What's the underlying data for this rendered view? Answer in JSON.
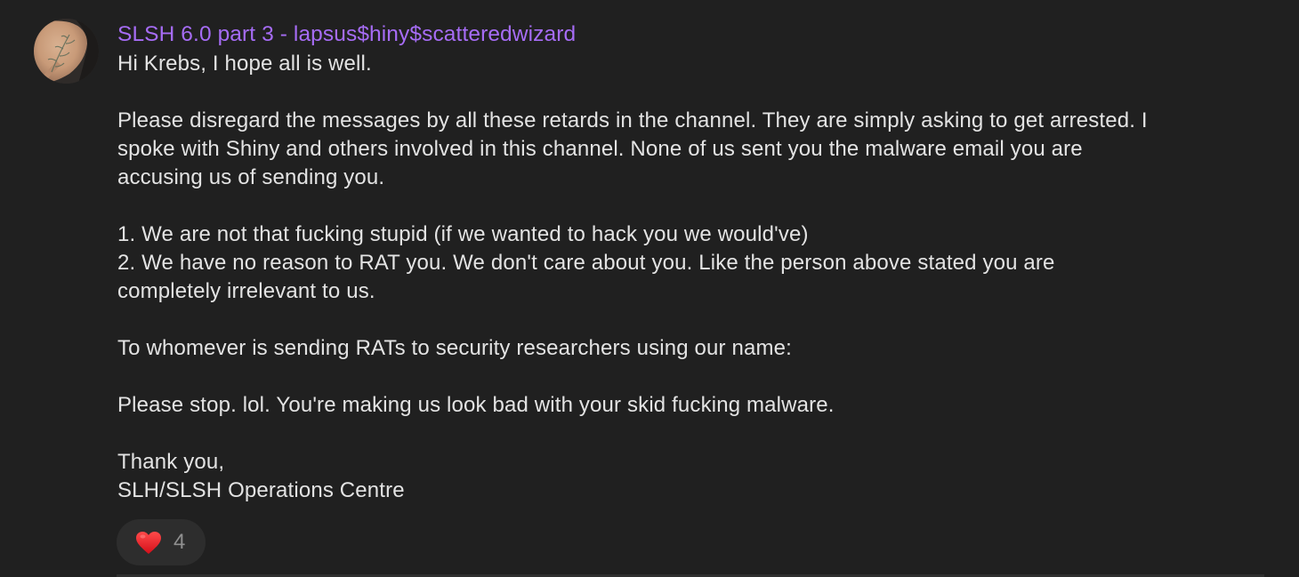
{
  "message": {
    "author": "SLSH 6.0 part 3 - lapsus$hiny$scatteredwizard",
    "author_color": "#a66cf5",
    "paragraphs": [
      [
        "Hi Krebs, I hope all is well."
      ],
      [
        "Please disregard the messages by all these retards in the channel. They are simply asking to get arrested. I",
        "spoke with Shiny and others involved in this channel. None of us sent you the malware email you are",
        "accusing us of sending you."
      ],
      [
        "1. We are not that fucking stupid (if we wanted to hack you we would've)",
        "2. We have no reason to RAT you. We don't care about you. Like the person above stated you are",
        "completely irrelevant to us."
      ],
      [
        "To whomever is sending RATs to security researchers using our name:"
      ],
      [
        "Please stop. lol. You're making us look bad with your skid fucking malware."
      ],
      [
        "Thank you,",
        "SLH/SLSH Operations Centre"
      ]
    ]
  },
  "reaction": {
    "icon": "red-heart-icon",
    "count": "4"
  },
  "avatar": {
    "icon": "tattooed-hand-avatar"
  }
}
